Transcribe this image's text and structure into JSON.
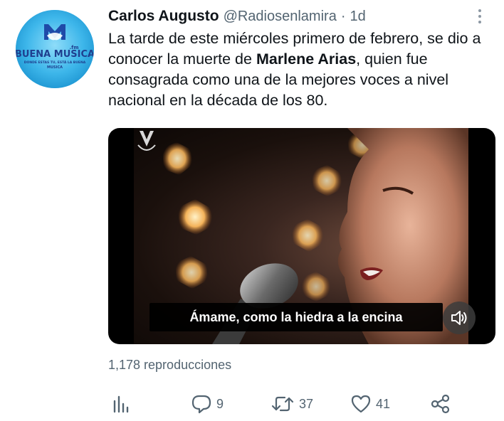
{
  "tweet": {
    "author_name": "Carlos Augusto",
    "handle": "@Radiosenlamira",
    "separator": "·",
    "time": "1d",
    "text_before": "La tarde de este miércoles primero de febrero, se dio a conocer la muerte de ",
    "text_bold": "Marlene Arias",
    "text_after": ", quien fue consagrada como una de la mejores voces a nivel nacional en la década de los 80.",
    "avatar": {
      "icon": "buena-musica-logo",
      "brand_text": "BUENA MUSICA",
      "fm_text": ".fm",
      "tagline": "DONDE ESTAS TU, ESTÁ LA BUENA",
      "sub_text": "MUSICA"
    }
  },
  "media": {
    "watermark_icon": "venevision-logo",
    "caption": "Ámame, como la hiedra a la encina",
    "mute_icon": "speaker-muted-icon"
  },
  "views": "1,178 reproducciones",
  "actions": {
    "analytics_icon": "analytics-icon",
    "reply_count": "9",
    "retweet_count": "37",
    "like_count": "41",
    "share_icon": "share-icon"
  },
  "colors": {
    "text_primary": "#0f1419",
    "text_secondary": "#536471",
    "avatar_blue": "#38b4ea"
  }
}
